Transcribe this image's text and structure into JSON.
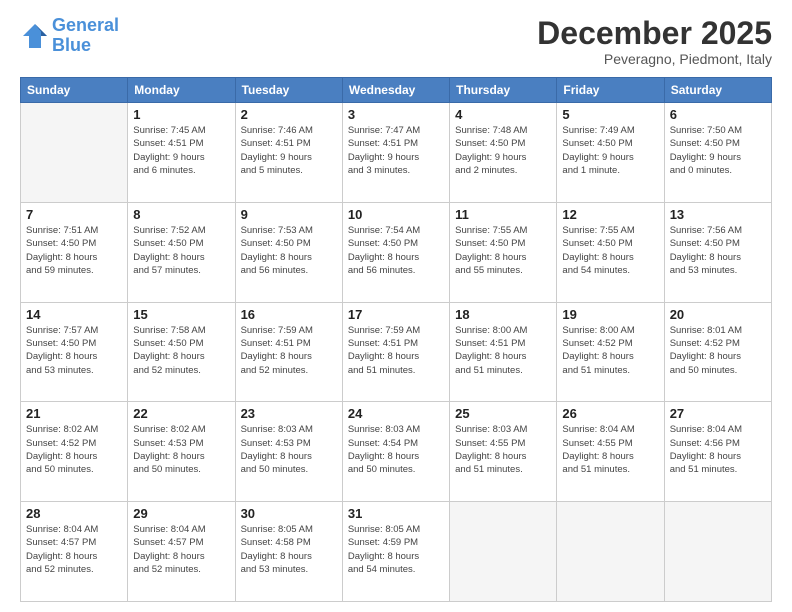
{
  "logo": {
    "line1": "General",
    "line2": "Blue"
  },
  "title": "December 2025",
  "subtitle": "Peveragno, Piedmont, Italy",
  "weekdays": [
    "Sunday",
    "Monday",
    "Tuesday",
    "Wednesday",
    "Thursday",
    "Friday",
    "Saturday"
  ],
  "weeks": [
    [
      {
        "day": "",
        "info": ""
      },
      {
        "day": "1",
        "info": "Sunrise: 7:45 AM\nSunset: 4:51 PM\nDaylight: 9 hours\nand 6 minutes."
      },
      {
        "day": "2",
        "info": "Sunrise: 7:46 AM\nSunset: 4:51 PM\nDaylight: 9 hours\nand 5 minutes."
      },
      {
        "day": "3",
        "info": "Sunrise: 7:47 AM\nSunset: 4:51 PM\nDaylight: 9 hours\nand 3 minutes."
      },
      {
        "day": "4",
        "info": "Sunrise: 7:48 AM\nSunset: 4:50 PM\nDaylight: 9 hours\nand 2 minutes."
      },
      {
        "day": "5",
        "info": "Sunrise: 7:49 AM\nSunset: 4:50 PM\nDaylight: 9 hours\nand 1 minute."
      },
      {
        "day": "6",
        "info": "Sunrise: 7:50 AM\nSunset: 4:50 PM\nDaylight: 9 hours\nand 0 minutes."
      }
    ],
    [
      {
        "day": "7",
        "info": "Sunrise: 7:51 AM\nSunset: 4:50 PM\nDaylight: 8 hours\nand 59 minutes."
      },
      {
        "day": "8",
        "info": "Sunrise: 7:52 AM\nSunset: 4:50 PM\nDaylight: 8 hours\nand 57 minutes."
      },
      {
        "day": "9",
        "info": "Sunrise: 7:53 AM\nSunset: 4:50 PM\nDaylight: 8 hours\nand 56 minutes."
      },
      {
        "day": "10",
        "info": "Sunrise: 7:54 AM\nSunset: 4:50 PM\nDaylight: 8 hours\nand 56 minutes."
      },
      {
        "day": "11",
        "info": "Sunrise: 7:55 AM\nSunset: 4:50 PM\nDaylight: 8 hours\nand 55 minutes."
      },
      {
        "day": "12",
        "info": "Sunrise: 7:55 AM\nSunset: 4:50 PM\nDaylight: 8 hours\nand 54 minutes."
      },
      {
        "day": "13",
        "info": "Sunrise: 7:56 AM\nSunset: 4:50 PM\nDaylight: 8 hours\nand 53 minutes."
      }
    ],
    [
      {
        "day": "14",
        "info": "Sunrise: 7:57 AM\nSunset: 4:50 PM\nDaylight: 8 hours\nand 53 minutes."
      },
      {
        "day": "15",
        "info": "Sunrise: 7:58 AM\nSunset: 4:50 PM\nDaylight: 8 hours\nand 52 minutes."
      },
      {
        "day": "16",
        "info": "Sunrise: 7:59 AM\nSunset: 4:51 PM\nDaylight: 8 hours\nand 52 minutes."
      },
      {
        "day": "17",
        "info": "Sunrise: 7:59 AM\nSunset: 4:51 PM\nDaylight: 8 hours\nand 51 minutes."
      },
      {
        "day": "18",
        "info": "Sunrise: 8:00 AM\nSunset: 4:51 PM\nDaylight: 8 hours\nand 51 minutes."
      },
      {
        "day": "19",
        "info": "Sunrise: 8:00 AM\nSunset: 4:52 PM\nDaylight: 8 hours\nand 51 minutes."
      },
      {
        "day": "20",
        "info": "Sunrise: 8:01 AM\nSunset: 4:52 PM\nDaylight: 8 hours\nand 50 minutes."
      }
    ],
    [
      {
        "day": "21",
        "info": "Sunrise: 8:02 AM\nSunset: 4:52 PM\nDaylight: 8 hours\nand 50 minutes."
      },
      {
        "day": "22",
        "info": "Sunrise: 8:02 AM\nSunset: 4:53 PM\nDaylight: 8 hours\nand 50 minutes."
      },
      {
        "day": "23",
        "info": "Sunrise: 8:03 AM\nSunset: 4:53 PM\nDaylight: 8 hours\nand 50 minutes."
      },
      {
        "day": "24",
        "info": "Sunrise: 8:03 AM\nSunset: 4:54 PM\nDaylight: 8 hours\nand 50 minutes."
      },
      {
        "day": "25",
        "info": "Sunrise: 8:03 AM\nSunset: 4:55 PM\nDaylight: 8 hours\nand 51 minutes."
      },
      {
        "day": "26",
        "info": "Sunrise: 8:04 AM\nSunset: 4:55 PM\nDaylight: 8 hours\nand 51 minutes."
      },
      {
        "day": "27",
        "info": "Sunrise: 8:04 AM\nSunset: 4:56 PM\nDaylight: 8 hours\nand 51 minutes."
      }
    ],
    [
      {
        "day": "28",
        "info": "Sunrise: 8:04 AM\nSunset: 4:57 PM\nDaylight: 8 hours\nand 52 minutes."
      },
      {
        "day": "29",
        "info": "Sunrise: 8:04 AM\nSunset: 4:57 PM\nDaylight: 8 hours\nand 52 minutes."
      },
      {
        "day": "30",
        "info": "Sunrise: 8:05 AM\nSunset: 4:58 PM\nDaylight: 8 hours\nand 53 minutes."
      },
      {
        "day": "31",
        "info": "Sunrise: 8:05 AM\nSunset: 4:59 PM\nDaylight: 8 hours\nand 54 minutes."
      },
      {
        "day": "",
        "info": ""
      },
      {
        "day": "",
        "info": ""
      },
      {
        "day": "",
        "info": ""
      }
    ]
  ]
}
